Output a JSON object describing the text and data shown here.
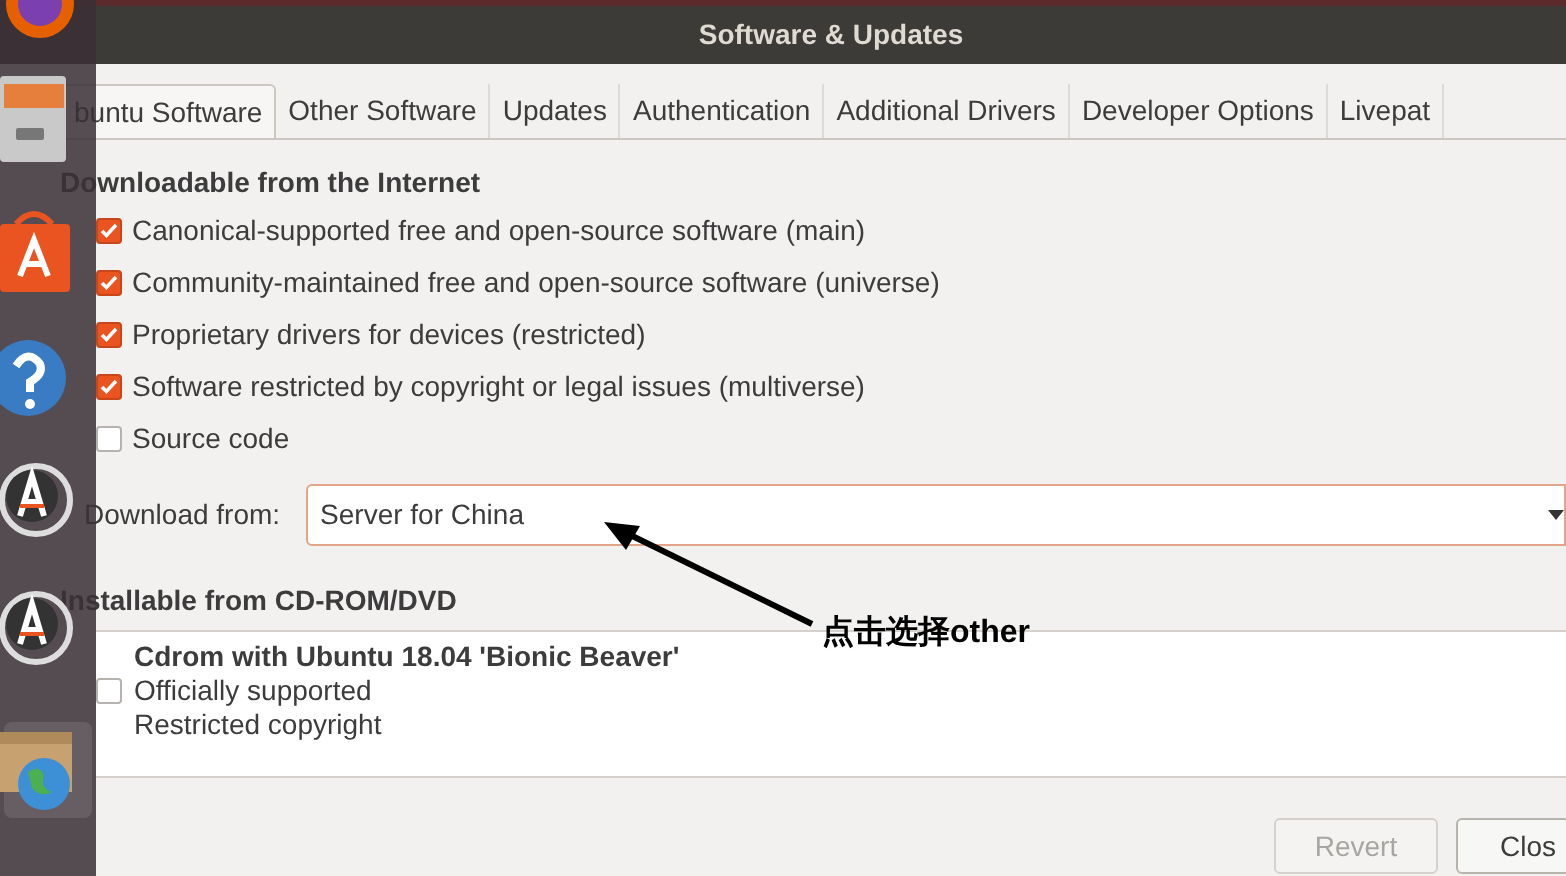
{
  "window": {
    "title": "Software & Updates"
  },
  "tabs": [
    {
      "label": "buntu Software",
      "selected": true
    },
    {
      "label": "Other Software",
      "selected": false
    },
    {
      "label": "Updates",
      "selected": false
    },
    {
      "label": "Authentication",
      "selected": false
    },
    {
      "label": "Additional Drivers",
      "selected": false
    },
    {
      "label": "Developer Options",
      "selected": false
    },
    {
      "label": "Livepat",
      "selected": false
    }
  ],
  "internet": {
    "heading": "Downloadable from the Internet",
    "sources": [
      {
        "label": "Canonical-supported free and open-source software (main)",
        "checked": true
      },
      {
        "label": "Community-maintained free and open-source software (universe)",
        "checked": true
      },
      {
        "label": "Proprietary drivers for devices (restricted)",
        "checked": true
      },
      {
        "label": "Software restricted by copyright or legal issues (multiverse)",
        "checked": true
      },
      {
        "label": "Source code",
        "checked": false
      }
    ],
    "download_from": {
      "label": "Download from:",
      "value": "Server for China"
    }
  },
  "cdrom": {
    "heading": "Installable from CD-ROM/DVD",
    "items": [
      {
        "title": "Cdrom with Ubuntu 18.04 'Bionic Beaver'",
        "lines": [
          "Officially supported",
          "Restricted copyright"
        ],
        "checked": false
      }
    ]
  },
  "buttons": [
    {
      "label": "Revert",
      "disabled": true
    },
    {
      "label": "Clos",
      "disabled": false
    }
  ],
  "annotation": {
    "text": "点击选择other"
  }
}
